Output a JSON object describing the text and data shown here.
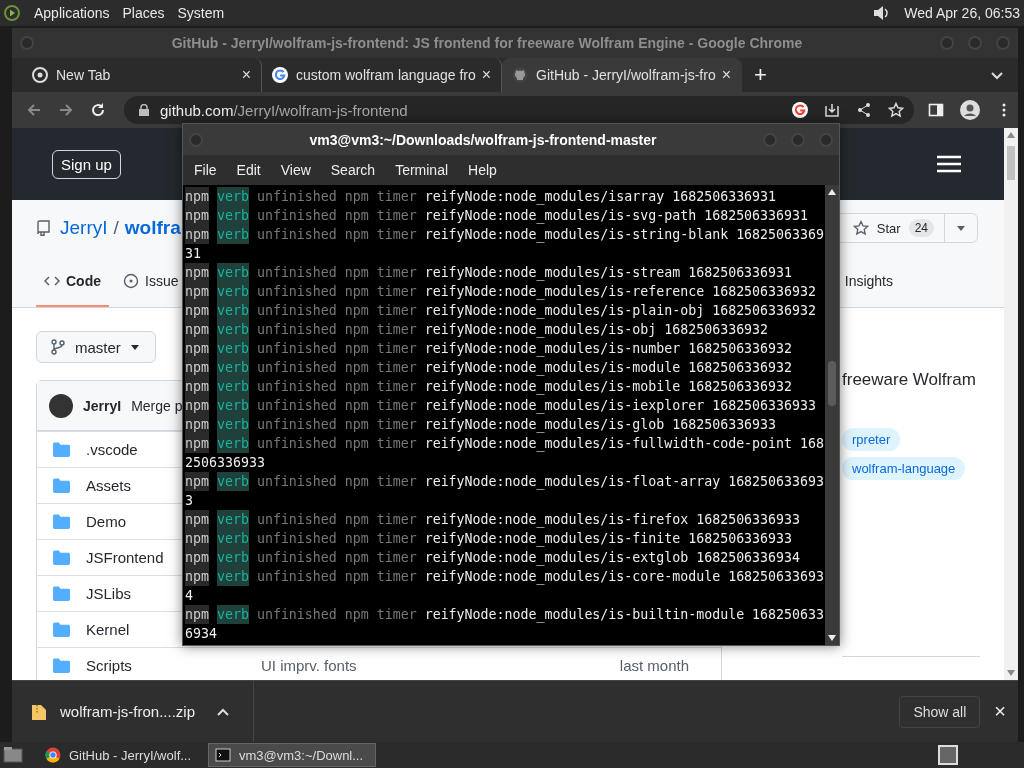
{
  "top_panel": {
    "menus": [
      "Applications",
      "Places",
      "System"
    ],
    "clock": "Wed Apr 26, 06:53"
  },
  "browser": {
    "title": "GitHub - JerryI/wolfram-js-frontend: JS frontend for freeware Wolfram Engine - Google Chrome",
    "tabs": [
      {
        "kind": "newtab",
        "label": "New Tab",
        "close": "×",
        "selected": false
      },
      {
        "kind": "google",
        "label": "custom wolfram language fro",
        "close": "×",
        "selected": false
      },
      {
        "kind": "github",
        "label": "GitHub - JerryI/wolfram-js-fro",
        "close": "×",
        "selected": true
      }
    ],
    "new_tab": "+",
    "address": {
      "host": "github.com",
      "path": "/JerryI/wolfram-js-frontend"
    },
    "page": {
      "sign_up": "Sign up",
      "owner": "JerryI",
      "separator": "/",
      "repo": "wolfra",
      "star": {
        "label": "Star",
        "count": "24"
      },
      "tabs": [
        {
          "label": "Code",
          "selected": true
        },
        {
          "label": "Issue",
          "selected": false
        },
        {
          "label": "Insights",
          "selected": false
        }
      ],
      "branch": "master",
      "commit": {
        "author": "JerryI",
        "message": "Merge p"
      },
      "files": [
        {
          "name": ".vscode"
        },
        {
          "name": "Assets"
        },
        {
          "name": "Demo"
        },
        {
          "name": "JSFrontend"
        },
        {
          "name": "JSLibs"
        },
        {
          "name": "Kernel"
        },
        {
          "name": "Scripts",
          "message": "UI imprv. fonts",
          "date": "last month"
        }
      ],
      "about": "freeware Wolfram",
      "topics": [
        "rpreter",
        "wolfram-language"
      ]
    },
    "download": {
      "file": "wolfram-js-fron....zip",
      "show_all": "Show all",
      "close": "×"
    }
  },
  "terminal": {
    "title": "vm3@vm3:~/Downloads/wolfram-js-frontend-master",
    "menu": [
      "File",
      "Edit",
      "View",
      "Search",
      "Terminal",
      "Help"
    ],
    "lines": [
      {
        "kind": "log",
        "prefix": "npm",
        "tag": "verb",
        "note": "unfinished npm timer",
        "text": "reifyNode:node_modules/isarray 1682506336931"
      },
      {
        "kind": "log",
        "prefix": "npm",
        "tag": "verb",
        "note": "unfinished npm timer",
        "text": "reifyNode:node_modules/is-svg-path 1682506336931"
      },
      {
        "kind": "log",
        "prefix": "npm",
        "tag": "verb",
        "note": "unfinished npm timer",
        "text": "reifyNode:node_modules/is-string-blank 16825063369"
      },
      {
        "kind": "wrap",
        "text": "31"
      },
      {
        "kind": "log",
        "prefix": "npm",
        "tag": "verb",
        "note": "unfinished npm timer",
        "text": "reifyNode:node_modules/is-stream 1682506336931"
      },
      {
        "kind": "log",
        "prefix": "npm",
        "tag": "verb",
        "note": "unfinished npm timer",
        "text": "reifyNode:node_modules/is-reference 1682506336932"
      },
      {
        "kind": "log",
        "prefix": "npm",
        "tag": "verb",
        "note": "unfinished npm timer",
        "text": "reifyNode:node_modules/is-plain-obj 1682506336932"
      },
      {
        "kind": "log",
        "prefix": "npm",
        "tag": "verb",
        "note": "unfinished npm timer",
        "text": "reifyNode:node_modules/is-obj 1682506336932"
      },
      {
        "kind": "log",
        "prefix": "npm",
        "tag": "verb",
        "note": "unfinished npm timer",
        "text": "reifyNode:node_modules/is-number 1682506336932"
      },
      {
        "kind": "log",
        "prefix": "npm",
        "tag": "verb",
        "note": "unfinished npm timer",
        "text": "reifyNode:node_modules/is-module 1682506336932"
      },
      {
        "kind": "log",
        "prefix": "npm",
        "tag": "verb",
        "note": "unfinished npm timer",
        "text": "reifyNode:node_modules/is-mobile 1682506336932"
      },
      {
        "kind": "log",
        "prefix": "npm",
        "tag": "verb",
        "note": "unfinished npm timer",
        "text": "reifyNode:node_modules/is-iexplorer 1682506336933"
      },
      {
        "kind": "log",
        "prefix": "npm",
        "tag": "verb",
        "note": "unfinished npm timer",
        "text": "reifyNode:node_modules/is-glob 1682506336933"
      },
      {
        "kind": "log",
        "prefix": "npm",
        "tag": "verb",
        "note": "unfinished npm timer",
        "text": "reifyNode:node_modules/is-fullwidth-code-point 168"
      },
      {
        "kind": "wrap",
        "text": "2506336933"
      },
      {
        "kind": "log",
        "prefix": "npm",
        "tag": "verb",
        "note": "unfinished npm timer",
        "text": "reifyNode:node_modules/is-float-array 168250633693"
      },
      {
        "kind": "wrap",
        "text": "3"
      },
      {
        "kind": "log",
        "prefix": "npm",
        "tag": "verb",
        "note": "unfinished npm timer",
        "text": "reifyNode:node_modules/is-firefox 1682506336933"
      },
      {
        "kind": "log",
        "prefix": "npm",
        "tag": "verb",
        "note": "unfinished npm timer",
        "text": "reifyNode:node_modules/is-finite 1682506336933"
      },
      {
        "kind": "log",
        "prefix": "npm",
        "tag": "verb",
        "note": "unfinished npm timer",
        "text": "reifyNode:node_modules/is-extglob 1682506336934"
      },
      {
        "kind": "log",
        "prefix": "npm",
        "tag": "verb",
        "note": "unfinished npm timer",
        "text": "reifyNode:node_modules/is-core-module 168250633693"
      },
      {
        "kind": "wrap",
        "text": "4"
      },
      {
        "kind": "log",
        "prefix": "npm",
        "tag": "verb",
        "note": "unfinished npm timer",
        "text": "reifyNode:node_modules/is-builtin-module 168250633"
      },
      {
        "kind": "wrap",
        "text": "6934"
      }
    ]
  },
  "taskbar": {
    "tasks": [
      {
        "kind": "browser",
        "label": "GitHub - JerryI/wolf...",
        "selected": false
      },
      {
        "kind": "terminal",
        "label": "vm3@vm3:~/Downl...",
        "selected": true
      }
    ]
  }
}
